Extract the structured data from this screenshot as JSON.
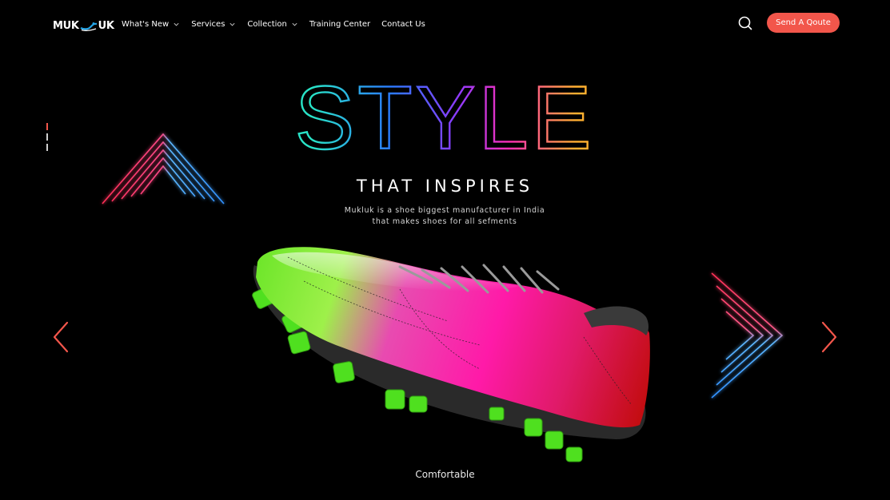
{
  "brand": {
    "logo_left": "MUK",
    "logo_right": "UK",
    "accent": "#f2564b"
  },
  "nav": {
    "items": [
      {
        "label": "What's New",
        "has_dropdown": true
      },
      {
        "label": "Services",
        "has_dropdown": true
      },
      {
        "label": "Collection",
        "has_dropdown": true
      },
      {
        "label": "Training Center",
        "has_dropdown": false
      },
      {
        "label": "Contact Us",
        "has_dropdown": false
      }
    ],
    "search_icon": "search-icon",
    "cta_label": "Send A Qoute"
  },
  "hero": {
    "title": "STYLE",
    "subtitle": "THAT INSPIRES",
    "description_line1": "Mukluk is a shoe biggest manufacturer in India",
    "description_line2": "that makes shoes for all sefments",
    "caption": "Comfortable"
  },
  "slider": {
    "prev_icon": "chevron-left-icon",
    "next_icon": "chevron-right-icon",
    "slide_count": 3,
    "active_slide": 1
  }
}
